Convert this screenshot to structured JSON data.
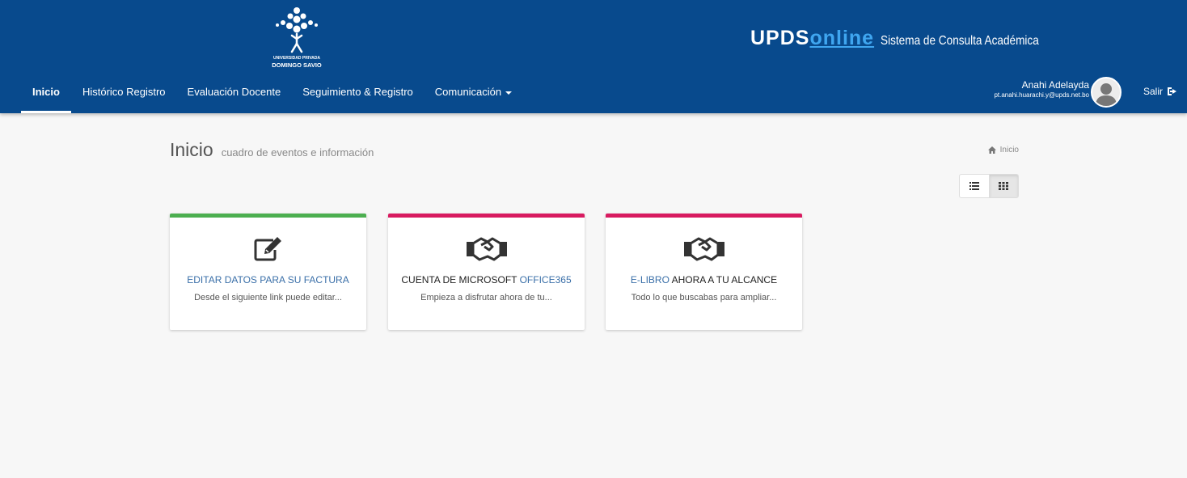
{
  "header": {
    "logo": {
      "line1": "UNIVERSIDAD PRIVADA",
      "line2": "DOMINGO SAVIO"
    },
    "brand": {
      "part1": "UPDS",
      "part2": "online",
      "subtitle": "Sistema de Consulta Académica"
    },
    "nav": [
      {
        "label": "Inicio",
        "active": true
      },
      {
        "label": "Histórico Registro"
      },
      {
        "label": "Evaluación Docente"
      },
      {
        "label": "Seguimiento & Registro"
      },
      {
        "label": "Comunicación",
        "dropdown": true
      }
    ],
    "user": {
      "name": "Anahi Adelayda",
      "email": "pt.anahi.huarachi.y@upds.net.bo",
      "avatar_icon": "user-avatar-icon"
    },
    "logout_label": "Salir",
    "colors": {
      "header_bg": "#084a8d",
      "brand_accent": "#3fa6f0"
    }
  },
  "page": {
    "title": "Inicio",
    "subtitle": "cuadro de eventos e información",
    "breadcrumb": "Inicio"
  },
  "view_toggle": {
    "options": [
      "list-view-icon",
      "grid-view-icon"
    ],
    "selected": "grid-view-icon"
  },
  "cards": [
    {
      "icon": "edit-icon",
      "title_pre": "",
      "title_hl": "EDITAR DATOS PARA SU FACTURA",
      "title_post": "",
      "description": "Desde el siguiente link puede editar...",
      "color": "#4caf50"
    },
    {
      "icon": "handshake-icon",
      "title_pre": "CUENTA DE MICROSOFT ",
      "title_hl": "OFFICE365",
      "title_post": "",
      "description": "Empieza a disfrutar ahora de tu...",
      "color": "#d81b60"
    },
    {
      "icon": "handshake-icon",
      "title_pre": "",
      "title_hl": "E-LIBRO",
      "title_post": " AHORA A TU ALCANCE",
      "description": "Todo lo que buscabas para ampliar...",
      "color": "#d81b60"
    }
  ]
}
